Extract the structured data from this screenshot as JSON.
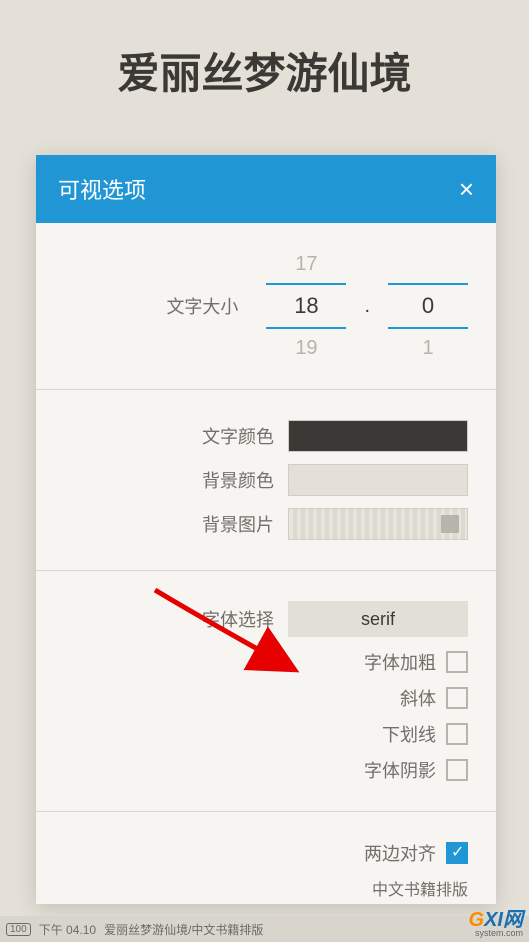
{
  "page_title": "爱丽丝梦游仙境",
  "dialog": {
    "title": "可视选项",
    "font_size": {
      "label": "文字大小",
      "prev_int": "17",
      "int": "18",
      "next_int": "19",
      "dot": ".",
      "prev_dec": "",
      "dec": "0",
      "next_dec": "1"
    },
    "text_color": {
      "label": "文字颜色"
    },
    "bg_color": {
      "label": "背景颜色"
    },
    "bg_image": {
      "label": "背景图片"
    },
    "font_select": {
      "label": "字体选择",
      "value": "serif"
    },
    "bold": {
      "label": "字体加粗"
    },
    "italic": {
      "label": "斜体"
    },
    "underline": {
      "label": "下划线"
    },
    "shadow": {
      "label": "字体阴影"
    },
    "justify": {
      "label": "两边对齐"
    },
    "cjk_layout": {
      "label": "中文书籍排版"
    }
  },
  "status": {
    "battery": "100",
    "time": "下午 04.10",
    "breadcrumb": "爱丽丝梦游仙境/中文书籍排版"
  },
  "watermark": {
    "text": "GXI网",
    "sub": "system.com"
  }
}
